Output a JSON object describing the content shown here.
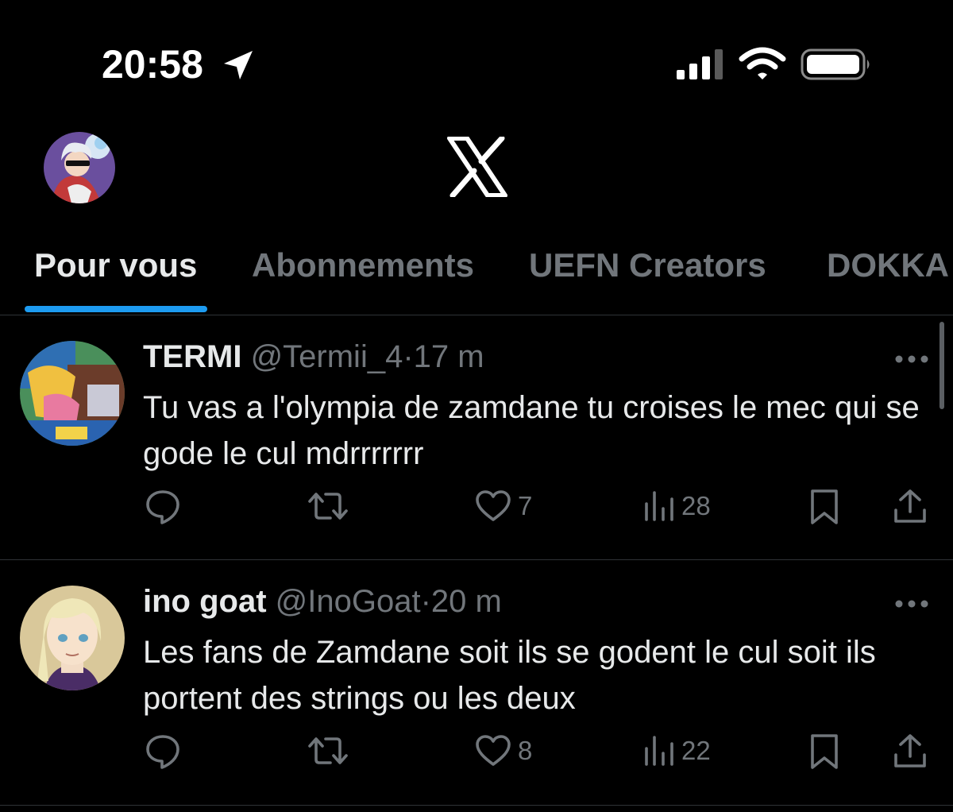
{
  "status_bar": {
    "time": "20:58",
    "icons": [
      "location-arrow-icon",
      "cellular-signal-icon",
      "wifi-icon",
      "battery-icon"
    ]
  },
  "header": {
    "logo": "x-logo"
  },
  "tabs": [
    {
      "label": "Pour vous",
      "active": true
    },
    {
      "label": "Abonnements",
      "active": false
    },
    {
      "label": "UEFN Creators",
      "active": false
    },
    {
      "label": "DOKKA",
      "active": false
    }
  ],
  "tweets": [
    {
      "name": "TERMI",
      "handle": "@Termii_4",
      "sep": "·",
      "time": "17 m",
      "text": "Tu vas a l'olympia de zamdane tu croises le mec qui se gode le cul mdrrrrrrr",
      "likes": "7",
      "views": "28"
    },
    {
      "name": "ino goat",
      "handle": "@InoGoat",
      "sep": "·",
      "time": "20 m",
      "text": "Les fans de Zamdane soit ils se godent le cul soit ils portent des strings ou les deux",
      "likes": "8",
      "views": "22"
    }
  ],
  "colors": {
    "background": "#000000",
    "text": "#e7e9ea",
    "muted": "#71767b",
    "accent": "#1d9bf0",
    "divider": "#2f3336"
  }
}
